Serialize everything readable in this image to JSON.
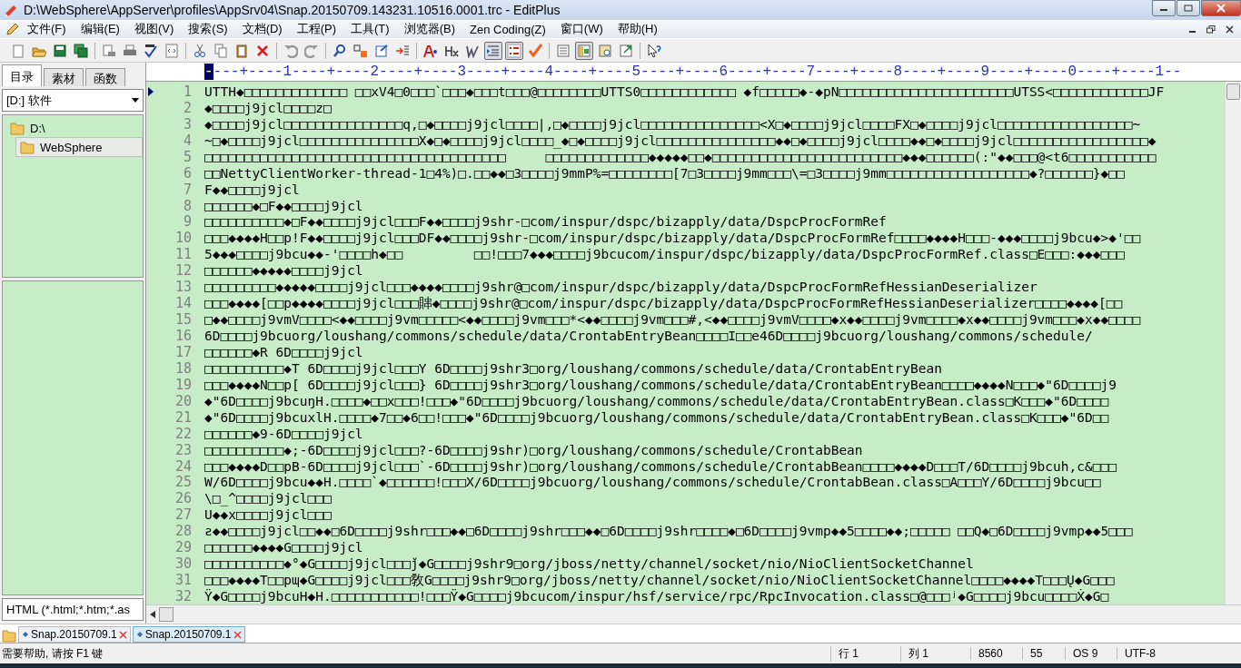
{
  "window": {
    "title": "D:\\WebSphere\\AppServer\\profiles\\AppSrv04\\Snap.20150709.143231.10516.0001.trc - EditPlus"
  },
  "menu": [
    "文件(F)",
    "编辑(E)",
    "视图(V)",
    "搜索(S)",
    "文档(D)",
    "工程(P)",
    "工具(T)",
    "浏览器(B)",
    "Zen Coding(Z)",
    "窗口(W)",
    "帮助(H)"
  ],
  "toolbar_toggles": [
    {
      "on": true
    },
    {
      "on": true
    },
    {
      "on": false
    },
    {
      "on": true
    }
  ],
  "sidebar": {
    "tabs": [
      {
        "label": "目录",
        "selected": true
      },
      {
        "label": "素材",
        "selected": false
      },
      {
        "label": "函数",
        "selected": false
      }
    ],
    "drive": "[D:] 软件",
    "tree": [
      {
        "label": "D:\\",
        "selected": false,
        "children": [
          {
            "label": "WebSphere",
            "selected": true
          }
        ]
      }
    ],
    "filter": "HTML (*.html;*.htm;*.as"
  },
  "ruler": "----+----1----+----2----+----3----+----4----+----5----+----6----+----7----+----8----+----9----+----0----+----1--",
  "lines": [
    {
      "n": "1",
      "current": true,
      "text": "UTTH◆□□□□□□□□□□□□□ □□xV4□0□□□`□□□◆□□□t□□□@□□□□□□□□UTTS0□□□□□□□□□□□□ ◆f□□□□□◆-◆pN□□□□□□□□□□□□□□□□□□□□□□UTSS<□□□□□□□□□□□□JF"
    },
    {
      "n": "2",
      "current": false,
      "text": "◆□□□□j9jcl□□□□z□"
    },
    {
      "n": "3",
      "current": false,
      "text": "◆□□□□j9jcl□□□□□□□□□□□□□□□q,□◆□□□□j9jcl□□□□|,□◆□□□□j9jcl□□□□□□□□□□□□□□□<X□◆□□□□j9jcl□□□□FX□◆□□□□j9jcl□□□□□□□□□□□□□□□□□~"
    },
    {
      "n": "4",
      "current": false,
      "text": "~□◆□□□□j9jcl□□□□□□□□□□□□□□□X◆□◆□□□□j9jcl□□□□_◆□◆□□□□j9jcl□□□□□□□□□□□□□□□◆◆□◆□□□□j9jcl□□□□◆◆□◆□□□□j9jcl□□□□□□□□□□□□□□□□□◆"
    },
    {
      "n": "5",
      "current": false,
      "text": "□□□□□□□□□□□□□□□□□□□□□□□□□□□□□□□□□□□□□□     □□□□□□□□□□□□□◆◆◆◆◆□□◆□□□□□□□□□□□□□□□□□□□□□□□□◆◆◆□□□□□□(:\"◆◆□□□@<t6□□□□□□□□□□□"
    },
    {
      "n": "6",
      "current": false,
      "text": "□□NettyClientWorker-thread-1□4%)□.□□◆◆□3□□□□j9mmP%=□□□□□□□□[7□3□□□□j9mm□□□\\=□3□□□□j9mm□□□□□□□□□□□□□□□□□□◆?□□□□□□}◆□□"
    },
    {
      "n": "7",
      "current": false,
      "text": "F◆◆□□□□j9jcl"
    },
    {
      "n": "8",
      "current": false,
      "text": "□□□□□□◆□F◆◆□□□□j9jcl"
    },
    {
      "n": "9",
      "current": false,
      "text": "□□□□□□□□□□◆□F◆◆□□□□j9jcl□□□F◆◆□□□□j9shr-□com/inspur/dspc/bizapply/data/DspcProcFormRef"
    },
    {
      "n": "10",
      "current": false,
      "text": "□□□◆◆◆◆H□□p!F◆◆□□□□j9jcl□□□DF◆◆□□□□j9shr-□com/inspur/dspc/bizapply/data/DspcProcFormRef□□□□◆◆◆◆H□□□-◆◆◆□□□□j9bcu◆>◆'□□"
    },
    {
      "n": "11",
      "current": false,
      "text": "5◆◆◆□□□□j9bcu◆◆-'□□□□h◆□□         □□!□□□7◆◆◆□□□□j9bcucom/inspur/dspc/bizapply/data/DspcProcFormRef.class□E□□□:◆◆◆□□□"
    },
    {
      "n": "12",
      "current": false,
      "text": "□□□□□□◆◆◆◆◆□□□□j9jcl"
    },
    {
      "n": "13",
      "current": false,
      "text": "□□□□□□□□□◆◆◆◆◆□□□□j9jcl□□□◆◆◆◆□□□□j9shr@□com/inspur/dspc/bizapply/data/DspcProcFormRefHessianDeserializer"
    },
    {
      "n": "14",
      "current": false,
      "text": "□□□◆◆◆◆[□□p◆◆◆◆□□□□j9jcl□□□賗◆□□□□j9shr@□com/inspur/dspc/bizapply/data/DspcProcFormRefHessianDeserializer□□□□◆◆◆◆[□□"
    },
    {
      "n": "15",
      "current": false,
      "text": "□◆◆□□□□j9vmV□□□□<◆◆□□□□j9vm□□□□□<◆◆□□□□j9vm□□□*<◆◆□□□□j9vm□□□#,<◆◆□□□□j9vmV□□□□◆x◆◆□□□□j9vm□□□□◆x◆◆□□□□j9vm□□□◆x◆◆□□□□"
    },
    {
      "n": "16",
      "current": false,
      "text": "6D□□□□j9bcuorg/loushang/commons/schedule/data/CrontabEntryBean□□□□I□□e46D□□□□j9bcuorg/loushang/commons/schedule/"
    },
    {
      "n": "17",
      "current": false,
      "text": "□□□□□□◆R 6D□□□□j9jcl"
    },
    {
      "n": "18",
      "current": false,
      "text": "□□□□□□□□□□◆T 6D□□□□j9jcl□□□Y 6D□□□□j9shr3□org/loushang/commons/schedule/data/CrontabEntryBean"
    },
    {
      "n": "19",
      "current": false,
      "text": "□□□◆◆◆◆N□□p[ 6D□□□□j9jcl□□□} 6D□□□□j9shr3□org/loushang/commons/schedule/data/CrontabEntryBean□□□□◆◆◆◆N□□□◆\"6D□□□□j9"
    },
    {
      "n": "20",
      "current": false,
      "text": "◆\"6D□□□□j9bcuŋH.□□□□◆□□x□□□!□□□◆\"6D□□□□j9bcuorg/loushang/commons/schedule/data/CrontabEntryBean.class□K□□□◆\"6D□□□□"
    },
    {
      "n": "21",
      "current": false,
      "text": "◆\"6D□□□□j9bcuxlH.□□□□◆7□□◆6□□!□□□◆\"6D□□□□j9bcuorg/loushang/commons/schedule/data/CrontabEntryBean.class□K□□□◆\"6D□□"
    },
    {
      "n": "22",
      "current": false,
      "text": "□□□□□□◆9-6D□□□□j9jcl"
    },
    {
      "n": "23",
      "current": false,
      "text": "□□□□□□□□□□◆;-6D□□□□j9jcl□□□?-6D□□□□j9shr)□org/loushang/commons/schedule/CrontabBean"
    },
    {
      "n": "24",
      "current": false,
      "text": "□□□◆◆◆◆D□□pB-6D□□□□j9jcl□□□`-6D□□□□j9shr)□org/loushang/commons/schedule/CrontabBean□□□□◆◆◆◆D□□□T/6D□□□□j9bcuh,c&□□□"
    },
    {
      "n": "25",
      "current": false,
      "text": "W/6D□□□□j9bcu◆◆H.□□□□`◆□□□□□□!□□□X/6D□□□□j9bcuorg/loushang/commons/schedule/CrontabBean.class□A□□□Y/6D□□□□j9bcu□□"
    },
    {
      "n": "26",
      "current": false,
      "text": "\\□_^□□□□j9jcl□□□"
    },
    {
      "n": "27",
      "current": false,
      "text": "U◆◆x□□□□j9jcl□□□"
    },
    {
      "n": "28",
      "current": false,
      "text": "ƨ◆◆□□□□j9jcl□□◆◆□6D□□□□j9shr□□□◆◆□6D□□□□j9shr□□□◆◆□6D□□□□j9shr□□□□◆□6D□□□□j9vmp◆◆5□□□□◆◆;□□□□□ □□Q◆□6D□□□□j9vmp◆◆5□□□"
    },
    {
      "n": "29",
      "current": false,
      "text": "□□□□□□◆◆◆◆G□□□□j9jcl"
    },
    {
      "n": "30",
      "current": false,
      "text": "□□□□□□□□□□◆°◆G□□□□j9jcl□□□ǰ◆G□□□□j9shr9□org/jboss/netty/channel/socket/nio/NioClientSocketChannel"
    },
    {
      "n": "31",
      "current": false,
      "text": "□□□◆◆◆◆T□□pɰ◆G□□□□j9jcl□□□敎G□□□□j9shr9□org/jboss/netty/channel/socket/nio/NioClientSocketChannel□□□□◆◆◆◆T□□□Ų◆G□□□"
    },
    {
      "n": "32",
      "current": false,
      "text": "Ÿ◆G□□□□j9bcuH◆H.□□□□□□□□□□□!□□□Ÿ◆G□□□□j9bcucom/inspur/hsf/service/rpc/RpcInvocation.class□@□□□ʲ◆G□□□□j9bcu□□□□Ẋ◆G□"
    }
  ],
  "doc_tabs": [
    {
      "label": "Snap.20150709.1",
      "selected": false
    },
    {
      "label": "Snap.20150709.1",
      "selected": true
    }
  ],
  "status_bar": {
    "help": "需要帮助, 请按 F1 键",
    "row": "行 1",
    "col": "列 1",
    "size": "8560",
    "lines": "55",
    "os": "OS 9",
    "encoding": "UTF-8"
  }
}
